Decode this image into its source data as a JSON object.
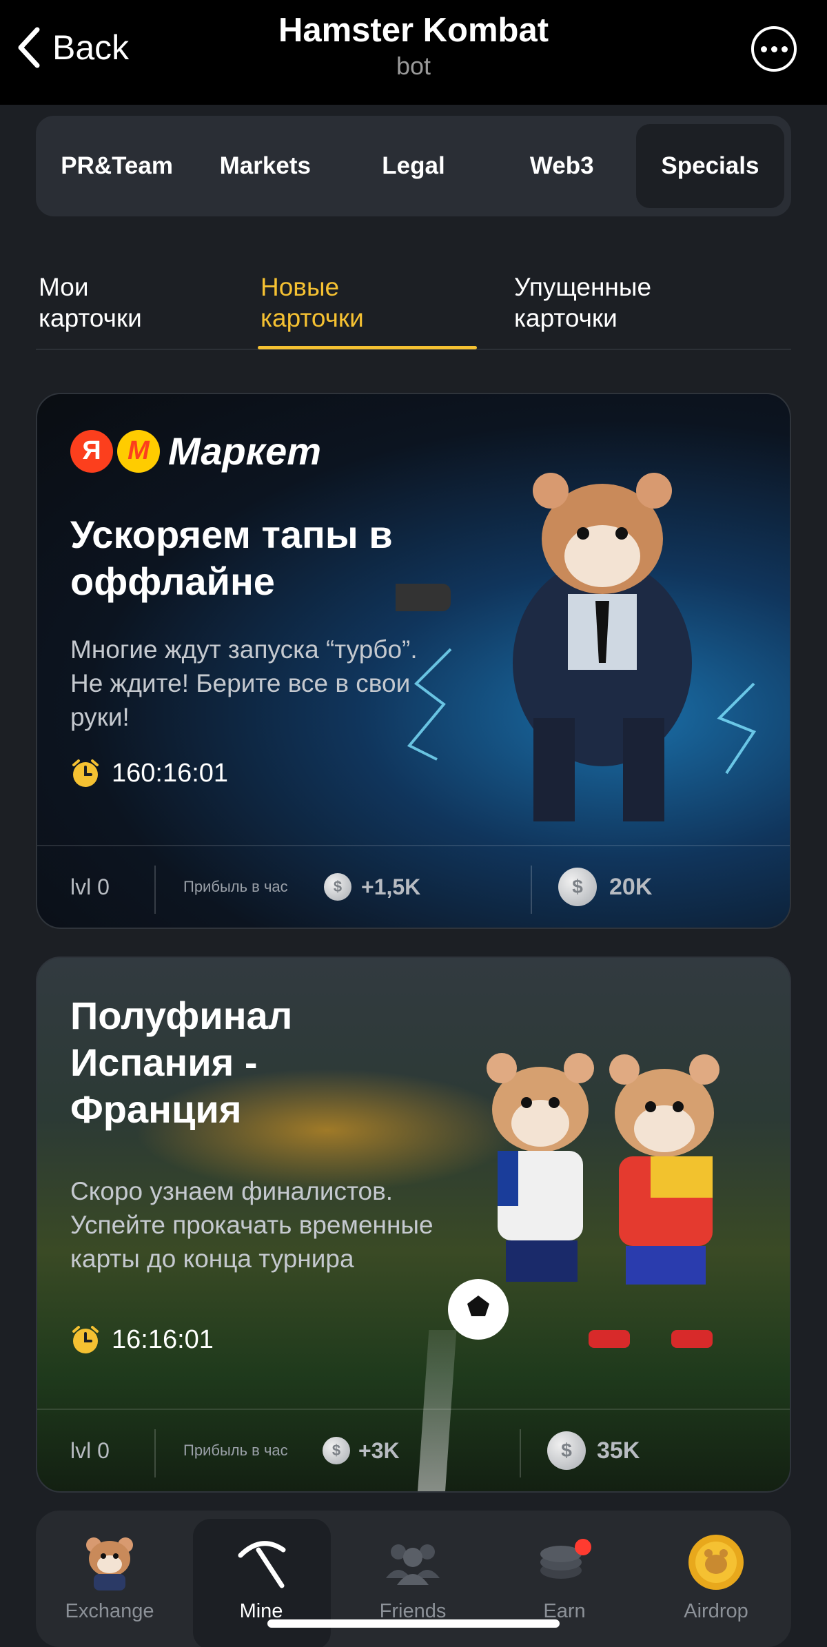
{
  "header": {
    "back_label": "Back",
    "title": "Hamster Kombat",
    "subtitle": "bot"
  },
  "categories": [
    {
      "label": "PR&Team",
      "active": false
    },
    {
      "label": "Markets",
      "active": false
    },
    {
      "label": "Legal",
      "active": false
    },
    {
      "label": "Web3",
      "active": false
    },
    {
      "label": "Specials",
      "active": true
    }
  ],
  "sub_tabs": [
    {
      "label": "Мои\nкарточки",
      "active": false
    },
    {
      "label": "Новые\nкарточки",
      "active": true
    },
    {
      "label": "Упущенные\nкарточки",
      "active": false
    }
  ],
  "cards": [
    {
      "brand_ya": "Я",
      "brand_m": "М",
      "brand_name": "Маркет",
      "title": "Ускоряем тапы в оффлайне",
      "description": "Многие ждут запуска “турбо”. Не ждите! Берите все в свои руки!",
      "timer": "160:16:01",
      "level": "lvl 0",
      "profit_label": "Прибыль в час",
      "profit_value": "+1,5K",
      "price": "20K"
    },
    {
      "title": "Полуфинал Испания - Франция",
      "description": "Скоро узнаем финалистов. Успейте прокачать временные карты до конца турнира",
      "timer": "16:16:01",
      "level": "lvl 0",
      "profit_label": "Прибыль в час",
      "profit_value": "+3K",
      "price": "35K"
    }
  ],
  "nav": [
    {
      "label": "Exchange",
      "icon": "hamster-icon",
      "active": false
    },
    {
      "label": "Mine",
      "icon": "pickaxe-icon",
      "active": true
    },
    {
      "label": "Friends",
      "icon": "friends-icon",
      "active": false
    },
    {
      "label": "Earn",
      "icon": "coins-icon",
      "active": false,
      "badge": true
    },
    {
      "label": "Airdrop",
      "icon": "airdrop-coin-icon",
      "active": false
    }
  ],
  "colors": {
    "accent": "#f5c132",
    "background": "#1c1f24",
    "panel": "#2a2e35",
    "badge": "#ff3b30"
  },
  "coin_symbol": "$"
}
